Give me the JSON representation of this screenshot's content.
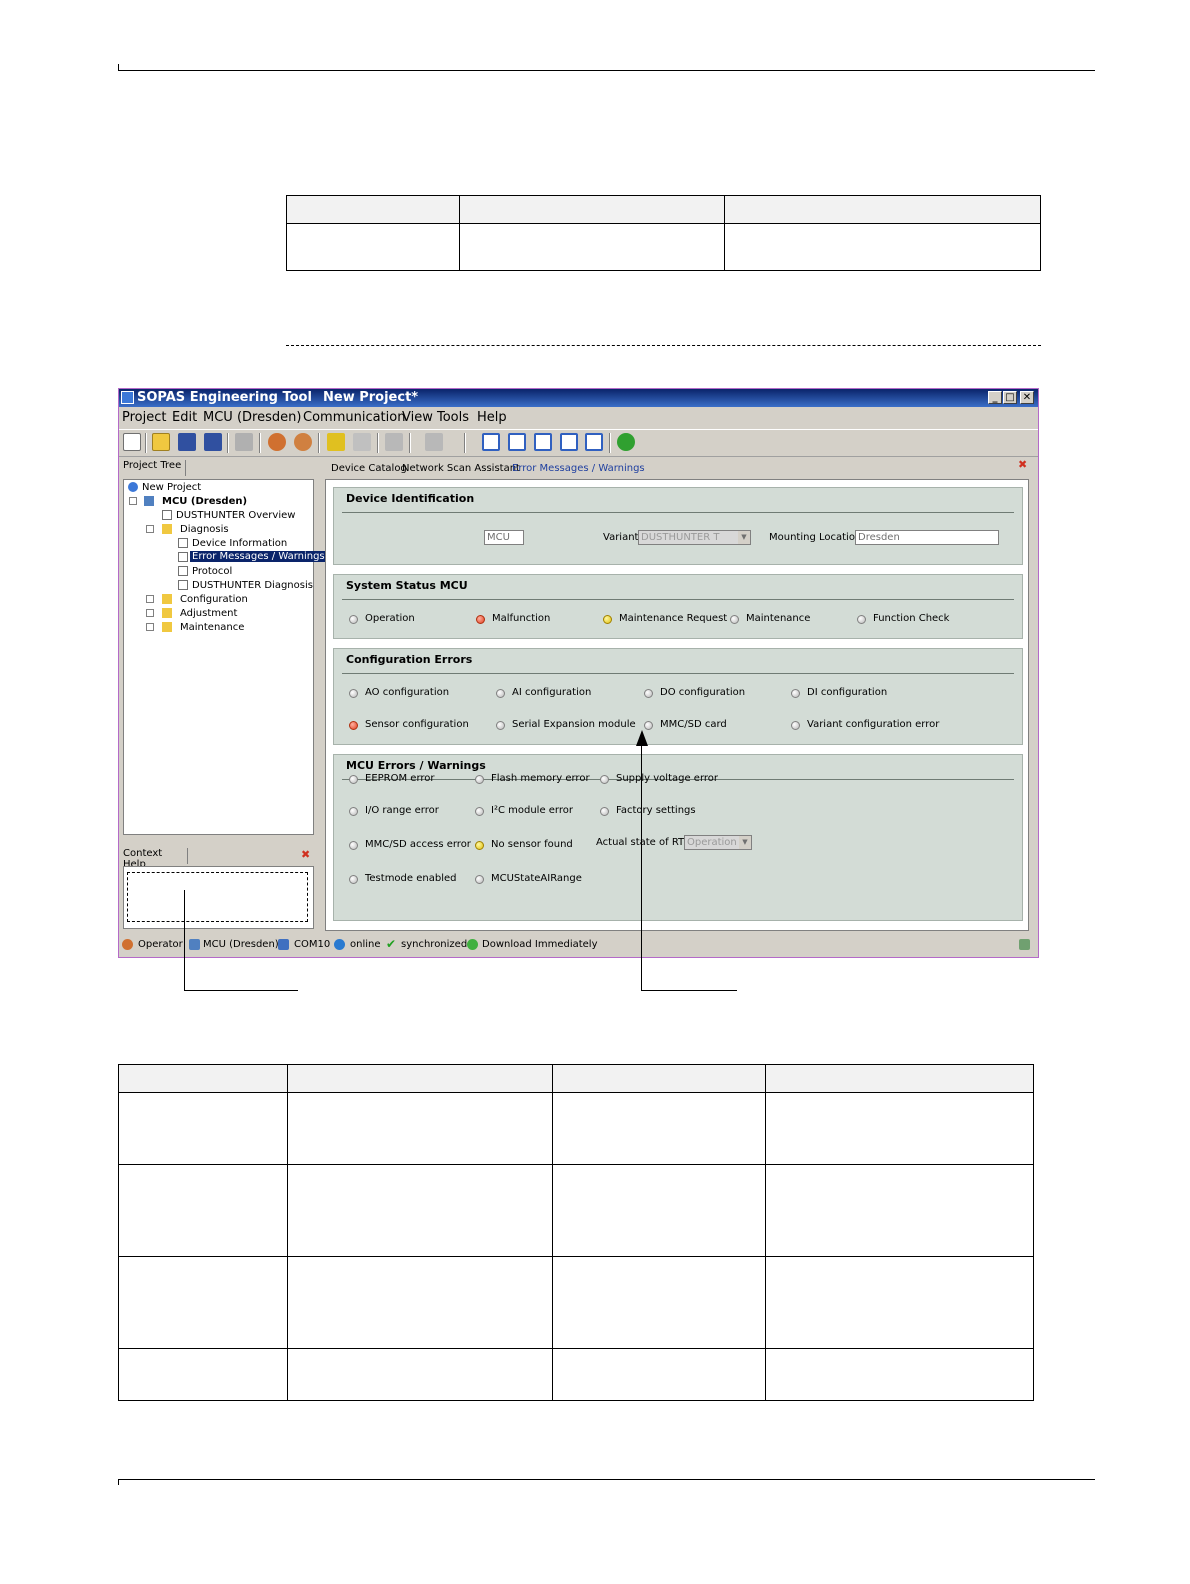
{
  "window": {
    "app_name": "SOPAS Engineering Tool",
    "project_title": "New Project*",
    "buttons": {
      "minimize": "_",
      "maximize": "□",
      "close": "✕"
    }
  },
  "menu": [
    "Project",
    "Edit",
    "MCU (Dresden)",
    "Communication",
    "View",
    "Tools",
    "Help"
  ],
  "project_tree": {
    "tab_label": "Project Tree",
    "items": [
      "New Project",
      "MCU (Dresden)",
      "DUSTHUNTER Overview",
      "Diagnosis",
      "Device Information",
      "Error Messages / Warnings",
      "Protocol",
      "DUSTHUNTER Diagnosis",
      "Configuration",
      "Adjustment",
      "Maintenance"
    ]
  },
  "context_help": {
    "tab_label": "Context Help"
  },
  "tabs": [
    "Device Catalog",
    "Network Scan Assistant",
    "Error Messages / Warnings"
  ],
  "device_identification": {
    "title": "Device Identification",
    "device_value": "MCU",
    "variant_label": "Variant",
    "variant_value": "DUSTHUNTER T",
    "mounting_label": "Mounting Location",
    "mounting_value": "Dresden"
  },
  "system_status": {
    "title": "System Status MCU",
    "items": [
      {
        "label": "Operation",
        "state": "off"
      },
      {
        "label": "Malfunction",
        "state": "red"
      },
      {
        "label": "Maintenance Request",
        "state": "yellow"
      },
      {
        "label": "Maintenance",
        "state": "off"
      },
      {
        "label": "Function Check",
        "state": "off"
      }
    ]
  },
  "configuration_errors": {
    "title": "Configuration Errors",
    "items": [
      {
        "label": "AO configuration",
        "state": "off"
      },
      {
        "label": "AI configuration",
        "state": "off"
      },
      {
        "label": "DO configuration",
        "state": "off"
      },
      {
        "label": "DI configuration",
        "state": "off"
      },
      {
        "label": "Sensor configuration",
        "state": "red"
      },
      {
        "label": "Serial Expansion module",
        "state": "off"
      },
      {
        "label": "MMC/SD card",
        "state": "off"
      },
      {
        "label": "Variant configuration error",
        "state": "off"
      }
    ]
  },
  "mcu_errors": {
    "title": "MCU Errors / Warnings",
    "items": [
      {
        "label": "EEPROM error",
        "state": "off"
      },
      {
        "label": "Flash memory error",
        "state": "off"
      },
      {
        "label": "Supply voltage error",
        "state": "off"
      },
      {
        "label": "I/O range error",
        "state": "off"
      },
      {
        "label": "I²C module error",
        "state": "off"
      },
      {
        "label": "Factory settings",
        "state": "off"
      },
      {
        "label": "MMC/SD access error",
        "state": "off"
      },
      {
        "label": "No sensor found",
        "state": "yellow"
      },
      {
        "label": "Testmode enabled",
        "state": "off"
      },
      {
        "label": "MCUStateAIRange",
        "state": "off"
      }
    ],
    "rtc_label": "Actual state of RTC",
    "rtc_value": "Operation"
  },
  "statusbar": [
    "Operator",
    "MCU (Dresden)",
    "COM10",
    "online",
    "synchronized",
    "Download Immediately"
  ],
  "colors": {
    "title_start": "#0a246a",
    "title_end": "#3a6ec8",
    "group_bg": "#d3dcd6",
    "led_red": "#e04020",
    "led_yellow": "#e0c010"
  }
}
